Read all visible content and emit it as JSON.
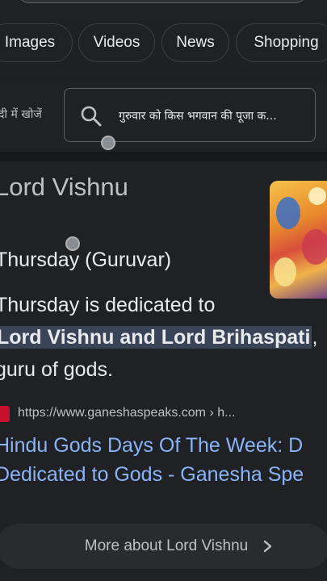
{
  "chips": [
    {
      "label": "Images"
    },
    {
      "label": "Videos"
    },
    {
      "label": "News"
    },
    {
      "label": "Shopping"
    }
  ],
  "translate": {
    "hindi_label": "दी में खोजें",
    "query": "गुरुवार को किस भगवान की पूजा क..."
  },
  "entity": {
    "title": "Lord Vishnu",
    "thumbnail_icon": "deity-painting-image"
  },
  "answer": {
    "short": "Thursday (Guruvar)",
    "line1": "Thursday is dedicated to",
    "highlight": "Lord Vishnu and Lord Brihaspati",
    "line2_tail": ",",
    "line3": "guru of gods."
  },
  "source": {
    "url": "https://www.ganeshaspeaks.com › h...",
    "link_line1": "Hindu Gods Days Of The Week: D",
    "link_line2": "Dedicated to Gods - Ganesha Spe"
  },
  "more": {
    "label": "More about Lord Vishnu"
  },
  "colors": {
    "background": "#202124",
    "link": "#8ab4f8",
    "highlight": "#394457"
  }
}
